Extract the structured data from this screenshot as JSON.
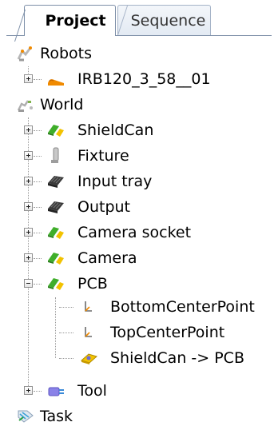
{
  "tabs": [
    {
      "label": "Project",
      "active": true
    },
    {
      "label": "Sequence",
      "active": false
    }
  ],
  "tree": {
    "robots_label": "Robots",
    "robot_item": "IRB120_3_58__01",
    "world_label": "World",
    "world_items": [
      "ShieldCan",
      "Fixture",
      "Input tray",
      "Output",
      "Camera socket",
      "Camera",
      "PCB"
    ],
    "pcb_children": [
      "BottomCenterPoint",
      "TopCenterPoint",
      "ShieldCan -> PCB"
    ],
    "tool_label": "Tool",
    "task_label": "Task"
  },
  "colors": {
    "tab_border": "#7d8fa8",
    "part_green": "#3fae2a",
    "part_yellow": "#f2c200",
    "robot_orange": "#f08a00",
    "tool_purple": "#8a82e8"
  },
  "icons": {
    "robots": "robots-folder-icon",
    "robot": "robot-arm-icon",
    "world": "world-station-icon",
    "part": "part-icon",
    "fixture": "fixture-icon",
    "tray": "tray-icon",
    "frame": "frame-icon",
    "attachment": "attachment-icon",
    "tool": "tool-icon",
    "task": "task-icon"
  }
}
